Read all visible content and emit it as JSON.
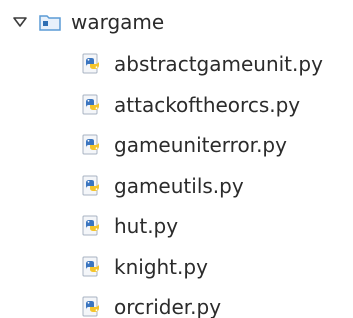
{
  "tree": {
    "folder": {
      "name": "wargame",
      "expanded": true,
      "icon": "package-folder-icon"
    },
    "files": [
      {
        "name": "abstractgameunit.py",
        "icon": "python-file-icon"
      },
      {
        "name": "attackoftheorcs.py",
        "icon": "python-file-icon"
      },
      {
        "name": "gameuniterror.py",
        "icon": "python-file-icon"
      },
      {
        "name": "gameutils.py",
        "icon": "python-file-icon"
      },
      {
        "name": "hut.py",
        "icon": "python-file-icon"
      },
      {
        "name": "knight.py",
        "icon": "python-file-icon"
      },
      {
        "name": "orcrider.py",
        "icon": "python-file-icon"
      }
    ]
  },
  "colors": {
    "python_blue": "#3a75c0",
    "python_yellow": "#f5c52b",
    "folder_blue": "#5b9bd5",
    "text": "#2b2b2b"
  }
}
